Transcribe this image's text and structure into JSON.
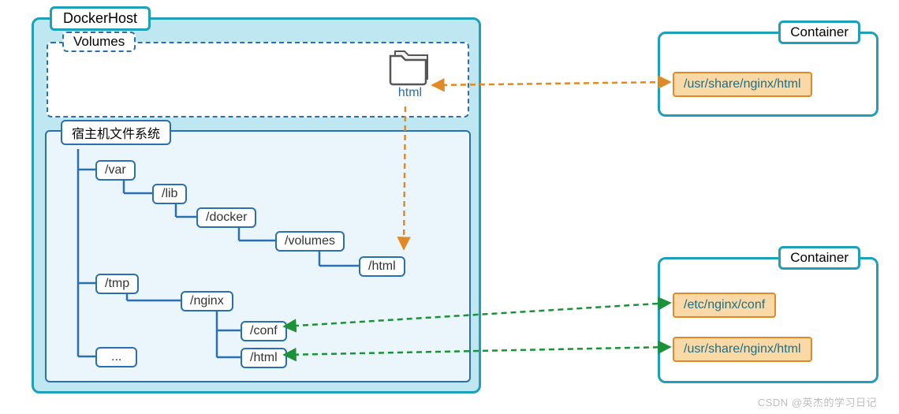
{
  "dockerhost_label": "DockerHost",
  "volumes_label": "Volumes",
  "volume_folder_label": "html",
  "hostfs_label": "宿主机文件系统",
  "tree": {
    "var": "/var",
    "lib": "/lib",
    "docker": "/docker",
    "volumes": "/volumes",
    "html_vol": "/html",
    "tmp": "/tmp",
    "nginx": "/nginx",
    "conf": "/conf",
    "html": "/html",
    "ellipsis": "..."
  },
  "container1": {
    "label": "Container",
    "path1": "/usr/share/nginx/html"
  },
  "container2": {
    "label": "Container",
    "path1": "/etc/nginx/conf",
    "path2": "/usr/share/nginx/html"
  },
  "watermark": "CSDN @英杰的学习日记",
  "colors": {
    "teal": "#1e9fba",
    "blue": "#2a6fb0",
    "orange": "#e08a27",
    "green": "#1c9138"
  }
}
